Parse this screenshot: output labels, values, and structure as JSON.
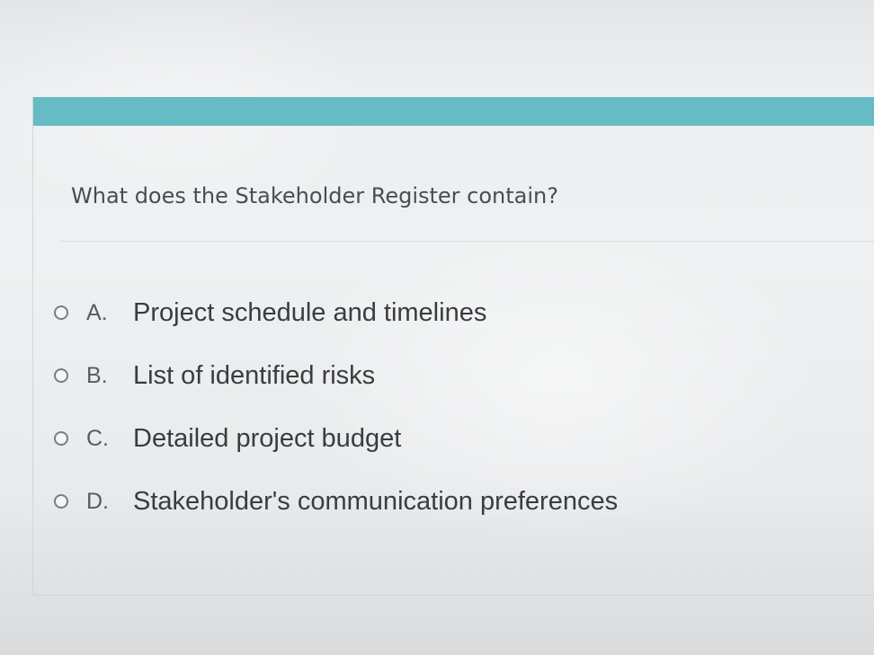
{
  "quiz": {
    "header_color": "#66bbc4",
    "question": "What does the Stakeholder Register contain?",
    "options": [
      {
        "letter": "A.",
        "text": "Project schedule and timelines",
        "selected": false
      },
      {
        "letter": "B.",
        "text": "List of identified risks",
        "selected": false
      },
      {
        "letter": "C.",
        "text": "Detailed project budget",
        "selected": false
      },
      {
        "letter": "D.",
        "text": "Stakeholder's communication preferences",
        "selected": false
      }
    ]
  },
  "icons": {
    "radio": "radio-unselected-icon"
  }
}
